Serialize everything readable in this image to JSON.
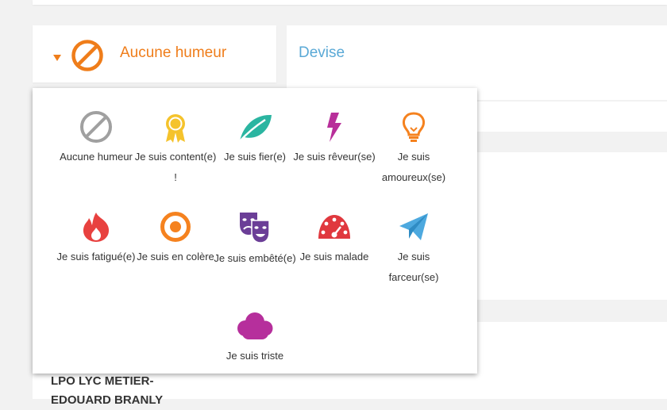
{
  "selector": {
    "label": "Aucune humeur",
    "icon": "no-mood-icon",
    "accent": "#ef7d1a"
  },
  "devise": {
    "title": "Devise",
    "color": "#5aa9d6"
  },
  "school": {
    "name": "LPO LYC METIER-EDOUARD BRANLY"
  },
  "moods": [
    {
      "label": "Aucune humeur",
      "icon": "no-mood-icon",
      "color": "#a0a0a0"
    },
    {
      "label": "Je suis content(e) !",
      "icon": "ribbon-medal-icon",
      "color": "#f5c32c"
    },
    {
      "label": "Je suis fier(e)",
      "icon": "leaf-icon",
      "color": "#2bb5a1"
    },
    {
      "label": "Je suis rêveur(se)",
      "icon": "lightning-icon",
      "color": "#b82f9a"
    },
    {
      "label": "Je suis amoureux(se)",
      "icon": "lightbulb-icon",
      "color": "#f5821f"
    },
    {
      "label": "Je suis fatigué(e)",
      "icon": "flame-icon",
      "color": "#e8413f"
    },
    {
      "label": "Je suis en colère",
      "icon": "target-icon",
      "color": "#f5821f"
    },
    {
      "label": "Je suis embêté(e)",
      "icon": "theater-masks-icon",
      "color": "#6b3e97"
    },
    {
      "label": "Je suis malade",
      "icon": "gauge-icon",
      "color": "#e0383e"
    },
    {
      "label": "Je suis farceur(se)",
      "icon": "paper-plane-icon",
      "color": "#4da9df"
    },
    {
      "label": "Je suis triste",
      "icon": "cloud-icon",
      "color": "#b62f9c"
    }
  ]
}
